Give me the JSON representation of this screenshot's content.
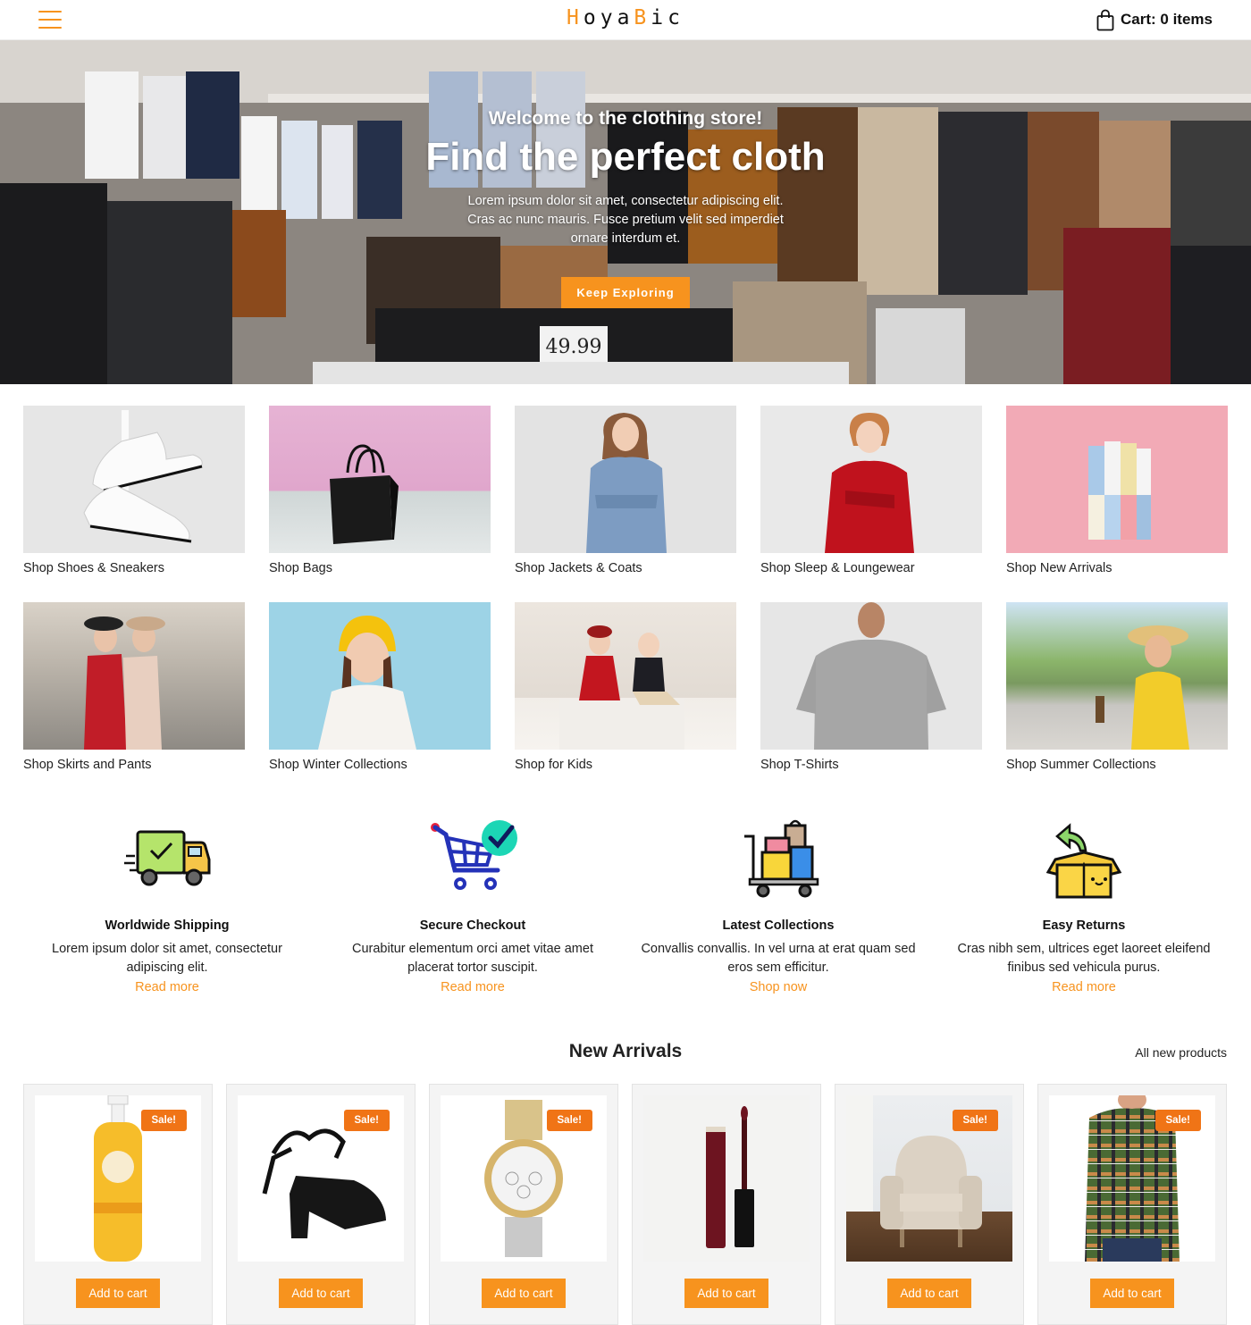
{
  "header": {
    "logo_parts": [
      "H",
      "oya",
      "B",
      "ic"
    ],
    "cart_label": "Cart: 0 items"
  },
  "hero": {
    "subtitle": "Welcome to the clothing store!",
    "title": "Find the perfect cloth",
    "text": "Lorem ipsum dolor sit amet, consectetur adipiscing elit. Cras ac nunc mauris. Fusce pretium velit sed imperdiet ornare interdum et.",
    "button_label": "Keep Exploring",
    "price_tag": "49.99"
  },
  "categories": [
    {
      "label": "Shop Shoes & Sneakers"
    },
    {
      "label": "Shop Bags"
    },
    {
      "label": "Shop Jackets & Coats"
    },
    {
      "label": "Shop Sleep & Loungewear"
    },
    {
      "label": "Shop New Arrivals"
    },
    {
      "label": "Shop Skirts and Pants"
    },
    {
      "label": "Shop Winter Collections"
    },
    {
      "label": "Shop for Kids"
    },
    {
      "label": "Shop T-Shirts"
    },
    {
      "label": "Shop Summer Collections"
    }
  ],
  "features": [
    {
      "icon": "truck-icon",
      "title": "Worldwide Shipping",
      "text": "Lorem ipsum dolor sit amet, consectetur adipiscing elit.",
      "link": "Read more"
    },
    {
      "icon": "cart-check-icon",
      "title": "Secure Checkout",
      "text": "Curabitur elementum orci amet vitae amet placerat tortor suscipit.",
      "link": "Read more"
    },
    {
      "icon": "trolley-icon",
      "title": "Latest Collections",
      "text": "Convallis convallis. In vel urna at erat quam sed eros sem efficitur.",
      "link": "Shop now"
    },
    {
      "icon": "return-box-icon",
      "title": "Easy Returns",
      "text": "Cras nibh sem, ultrices eget laoreet eleifend finibus sed vehicula purus.",
      "link": "Read more"
    }
  ],
  "arrivals": {
    "title": "New Arrivals",
    "all_link": "All new products",
    "sale_label": "Sale!",
    "add_label": "Add to cart",
    "products": [
      {
        "name": "shampoo",
        "sale": true
      },
      {
        "name": "sandal",
        "sale": true
      },
      {
        "name": "watch",
        "sale": true
      },
      {
        "name": "lip-gloss",
        "sale": false
      },
      {
        "name": "armchair",
        "sale": true
      },
      {
        "name": "flannel-shirt",
        "sale": true
      }
    ]
  },
  "colors": {
    "accent": "#f7931e",
    "sale": "#f07416"
  }
}
